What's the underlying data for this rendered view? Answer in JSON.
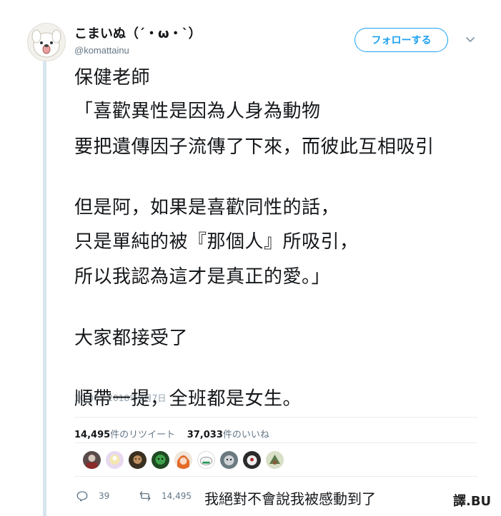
{
  "user": {
    "display_name": "こまいぬ（´・ω・`）",
    "handle": "@komattainu"
  },
  "follow_label": "フォローする",
  "tweet": {
    "lines": [
      "保健老師",
      "「喜歡異性是因為人身為動物",
      "要把遺傳因子流傳了下來，而彼此互相吸引",
      "但是阿，如果是喜歡同性的話，",
      "只是單純的被『那個人』所吸引，",
      "所以我認為這才是真正的愛。」",
      "大家都接受了",
      "順帶一提，全班都是女生。"
    ]
  },
  "timestamp": "10:06 - 2018年9月7日",
  "stats": {
    "retweet_count": "14,495",
    "retweet_label": "件のリツイート",
    "like_count": "37,033",
    "like_label": "件のいいね"
  },
  "actions": {
    "reply_count": "39",
    "retweet_count": "14,495"
  },
  "caption": "我絕對不會說我被感動到了",
  "watermark": "譯.BU",
  "colors": {
    "accent": "#1da1f2",
    "thread_line": "#d7e6ee"
  }
}
